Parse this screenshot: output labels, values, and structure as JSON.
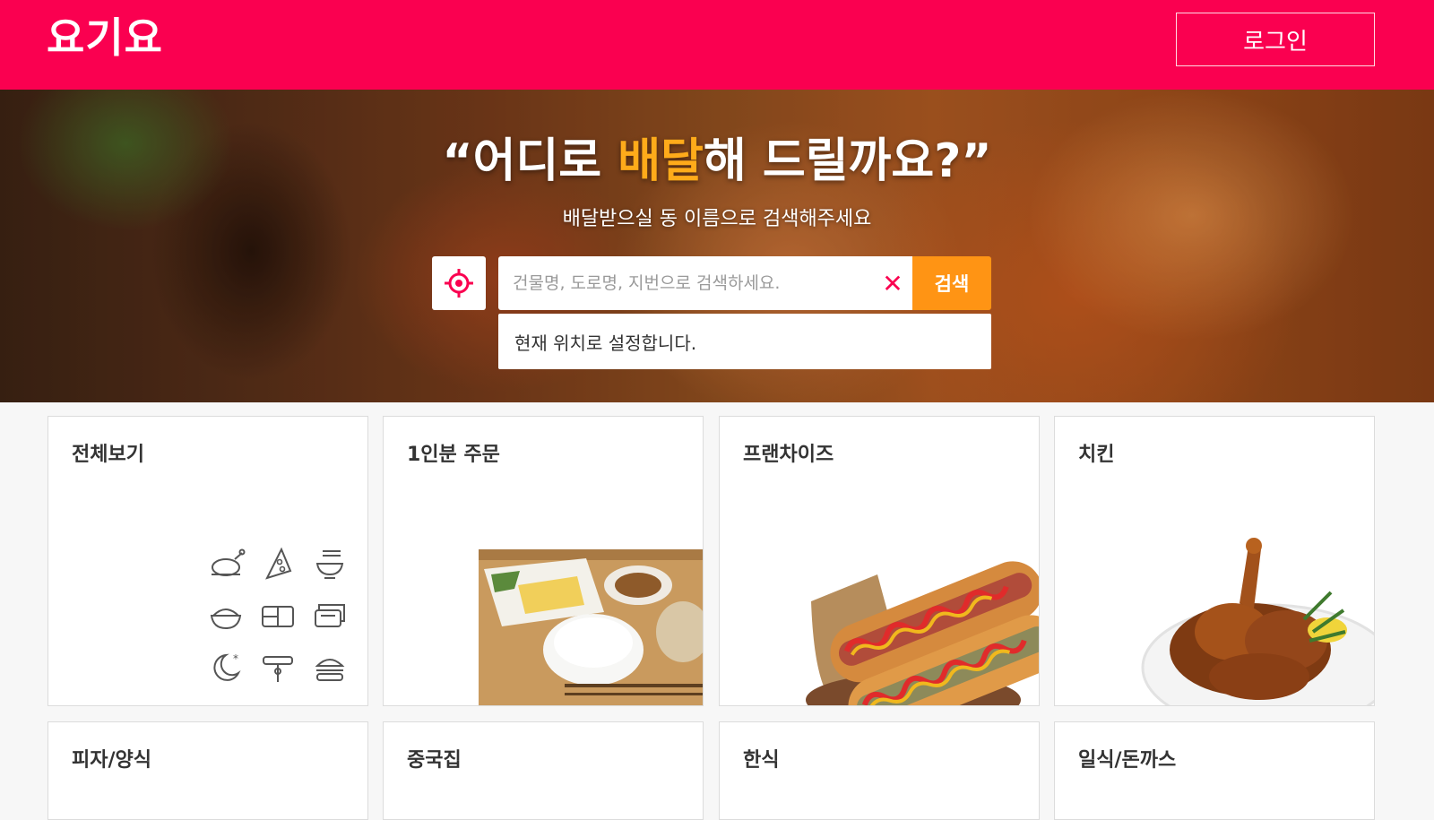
{
  "header": {
    "logo": "요기요",
    "login_label": "로그인"
  },
  "hero": {
    "title_prefix": "“어디로 ",
    "title_accent": "배달",
    "title_suffix": "해 드릴까요?”",
    "subtitle": "배달받으실 동 이름으로 검색해주세요",
    "search": {
      "placeholder": "건물명, 도로명, 지번으로 검색하세요.",
      "value": "",
      "clear_label": "✕",
      "button_label": "검색"
    },
    "suggestion": "현재 위치로 설정합니다."
  },
  "categories": [
    {
      "label": "전체보기"
    },
    {
      "label": "1인분 주문"
    },
    {
      "label": "프랜차이즈"
    },
    {
      "label": "치킨"
    },
    {
      "label": "피자/양식"
    },
    {
      "label": "중국집"
    },
    {
      "label": "한식"
    },
    {
      "label": "일식/돈까스"
    }
  ],
  "all_view_icons": [
    "chicken-icon",
    "pizza-icon",
    "noodle-bowl-icon",
    "rice-bowl-icon",
    "lunchbox-icon",
    "sushi-icon",
    "moon-night-icon",
    "tteokbokki-icon",
    "burger-icon"
  ],
  "colors": {
    "brand": "#fa0050",
    "accent": "#ff9414",
    "highlight": "#ffab1a"
  }
}
